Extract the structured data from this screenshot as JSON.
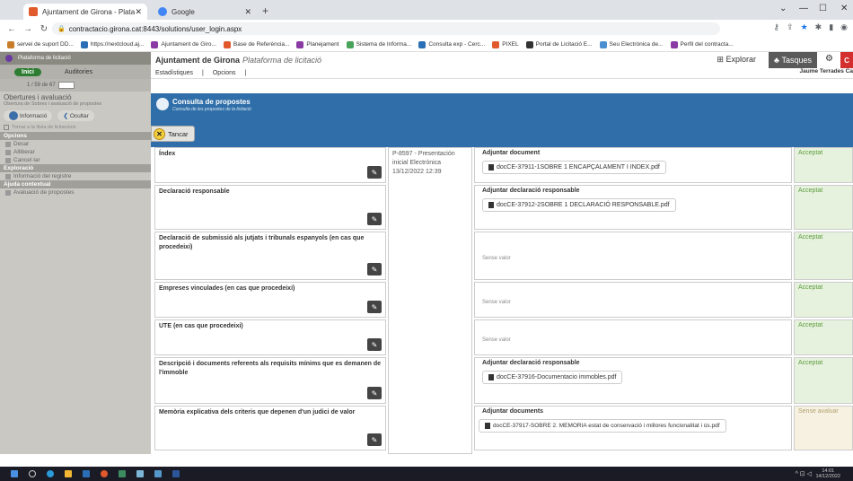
{
  "browser": {
    "tabs": [
      {
        "title": "Ajuntament de Girona - Platafor",
        "color": "#e05a2b",
        "active": true
      },
      {
        "title": "Google",
        "color": "#4285f4",
        "active": false
      }
    ],
    "url": "contractacio.girona.cat:8443/solutions/user_login.aspx",
    "bookmarks": [
      {
        "label": "servei de suport DD...",
        "color": "#c77d2a"
      },
      {
        "label": "https://nextcloud.aj...",
        "color": "#2a6fb5"
      },
      {
        "label": "Ajuntament de Giro...",
        "color": "#8a3aa3"
      },
      {
        "label": "Base de Referència...",
        "color": "#e0582c"
      },
      {
        "label": "Planejament",
        "color": "#8a3aa3"
      },
      {
        "label": "Sistema de Informa...",
        "color": "#4aa35a"
      },
      {
        "label": "Consulta exp - Cerc...",
        "color": "#2a6fb5"
      },
      {
        "label": "PIXEL",
        "color": "#e05a2b"
      },
      {
        "label": "Portal de Licitació E...",
        "color": "#333333"
      },
      {
        "label": "Seu Electrònica de...",
        "color": "#4a90d0"
      },
      {
        "label": "Perfil del contracta...",
        "color": "#8a3aa3"
      }
    ]
  },
  "sidebar": {
    "platform": "Plataforma de licitació",
    "tab_inici": "Inici",
    "tab_auditories": "Auditories",
    "pager": "1 / 59 de 67",
    "title": "Obertures i avaluació",
    "subtitle": "Obertura de Sobres i avaluació de propostes",
    "btn_informacio": "Informació",
    "btn_ocultar": "Ocultar",
    "checkbox_label": "Tornar a la llista de licitacions",
    "sec_opcions": "Opcions",
    "opt_desar": "Desar",
    "opt_alliberar": "Alliberar",
    "opt_cancel": "Cancel·lar",
    "sec_exploracio": "Exploració",
    "exp_info": "Informació del registre",
    "sec_ajuda": "Ajuda contextual",
    "ajuda_item": "Avaluació de propostes"
  },
  "app": {
    "org": "Ajuntament de Girona",
    "platform": "Plataforma de licitació",
    "explorar": "Explorar",
    "tasques": "Tasques",
    "nav_estadistiques": "Estadístiques",
    "nav_opcions": "Opcions",
    "username": "Jaume Terrades Ca",
    "red_badge": "C"
  },
  "header": {
    "title": "Consulta de propostes",
    "subtitle": "Consulta de les propostes de la licitació",
    "tancar": "Tancar"
  },
  "proposal": {
    "ref": "P-8597 - Presentación inicial Electrònica 13/12/2022 12:39"
  },
  "rows": [
    {
      "label": "Índex",
      "action": "Adjuntar document",
      "doc": "docCE-37911-1SOBRE 1 ENCAPÇALAMENT I INDEX.pdf",
      "status": "Acceptat"
    },
    {
      "label": "Declaració responsable",
      "action": "Adjuntar declaració responsable",
      "doc": "docCE-37912-2SOBRE 1 DECLARACIÓ RESPONSABLE.pdf",
      "status": "Acceptat"
    },
    {
      "label": "Declaració de submissió als jutjats i tribunals espanyols (en cas que procedeixi)",
      "action": "",
      "doc": "",
      "empty": "Sense valor",
      "status": "Acceptat"
    },
    {
      "label": "Empreses vinculades (en cas que procedeixi)",
      "action": "",
      "doc": "",
      "empty": "Sense valor",
      "status": "Acceptat"
    },
    {
      "label": "UTE (en cas que procedeixi)",
      "action": "",
      "doc": "",
      "empty": "Sense valor",
      "status": "Acceptat"
    },
    {
      "label": "Descripció i documents referents als requisits mínims que es demanen de l'immoble",
      "action": "Adjuntar declaració responsable",
      "doc": "docCE-37916-Documentacio immobles.pdf",
      "status": "Acceptat"
    },
    {
      "label": "Memòria explicativa dels criteris que depenen d'un judici de valor",
      "action": "Adjuntar documents",
      "doc": "docCE-37917-SOBRE 2. MEMORIA estat de conservació i millores funcionalitat i ús.pdf",
      "status": "Sense avaluar"
    }
  ],
  "taskbar": {
    "time": "14:01",
    "date": "14/12/2022"
  }
}
